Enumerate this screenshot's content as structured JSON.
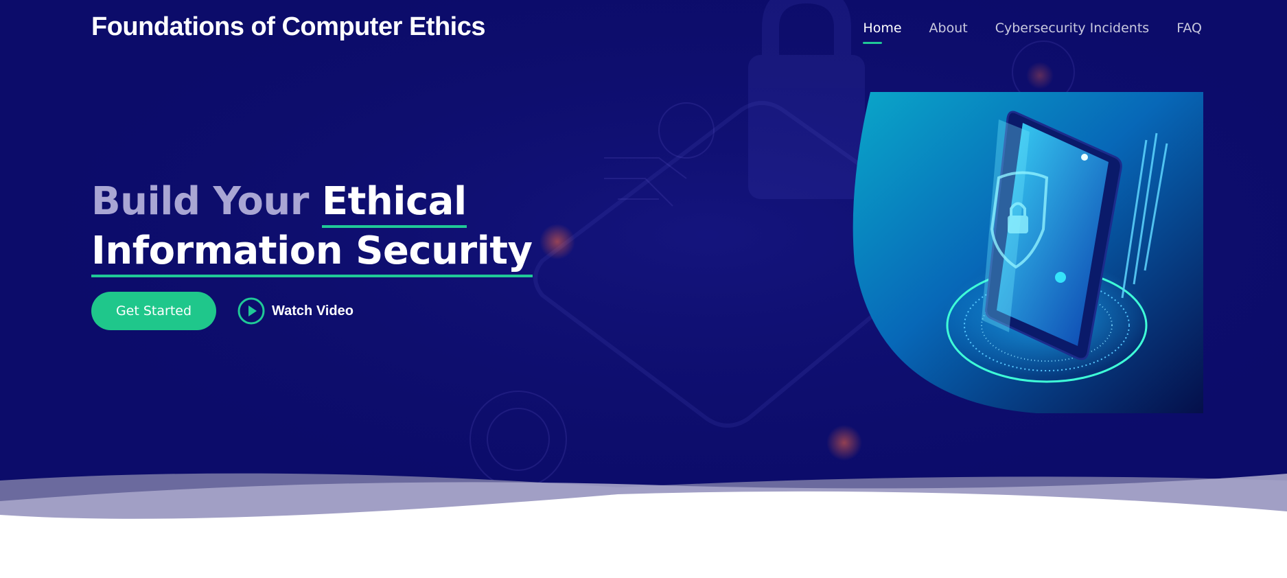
{
  "site": {
    "title": "Foundations of Computer Ethics"
  },
  "nav": {
    "items": [
      {
        "label": "Home",
        "name": "nav-home",
        "active": true
      },
      {
        "label": "About",
        "name": "nav-about",
        "active": false
      },
      {
        "label": "Cybersecurity Incidents",
        "name": "nav-cybersecurity-incidents",
        "active": false
      },
      {
        "label": "FAQ",
        "name": "nav-faq",
        "active": false
      }
    ]
  },
  "hero": {
    "headline_part1": "Build Your",
    "headline_part2": "Ethical",
    "headline_line2": "Information Security",
    "primary_button": "Get Started",
    "secondary_button": "Watch Video",
    "image_subject": "smartphone-security-illustration"
  },
  "colors": {
    "hero_background": "#0c0c6a",
    "accent": "#20c997",
    "button": "#1fc78b",
    "dim_text": "#a9a6d4"
  },
  "icons": {
    "play": "play-circle-icon",
    "lock": "padlock-icon",
    "shield": "shield-icon"
  }
}
